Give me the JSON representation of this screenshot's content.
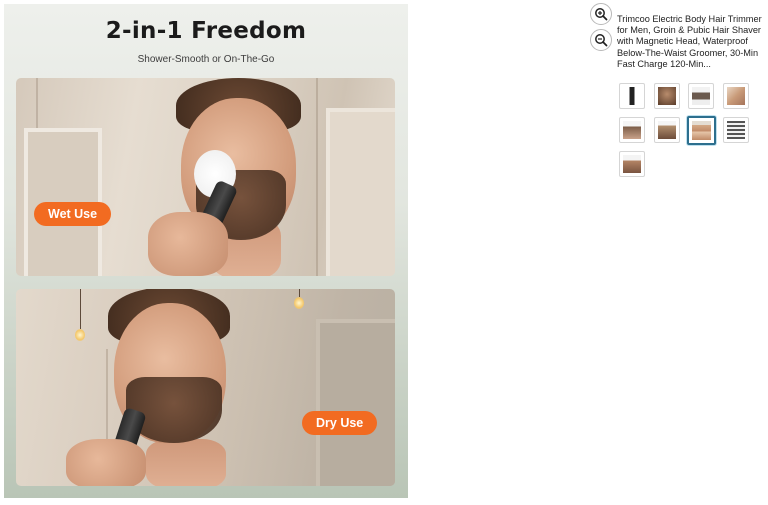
{
  "main_image": {
    "headline": "2-in-1 Freedom",
    "subline": "Shower-Smooth or On-The-Go",
    "badge_wet": "Wet Use",
    "badge_dry": "Dry Use",
    "badge_color": "#f26b21"
  },
  "controls": {
    "zoom_in_icon": "zoom-in-icon",
    "zoom_out_icon": "zoom-out-icon"
  },
  "product": {
    "title": "Trimcoo Electric Body Hair Trimmer for Men, Groin & Pubic Hair Shaver with Magnetic Head, Waterproof Below-The-Waist Groomer, 30-Min Fast Charge 120-Min..."
  },
  "thumbnails": {
    "count": 9,
    "selected_index": 6,
    "selected_border_color": "#2d6f8e"
  }
}
